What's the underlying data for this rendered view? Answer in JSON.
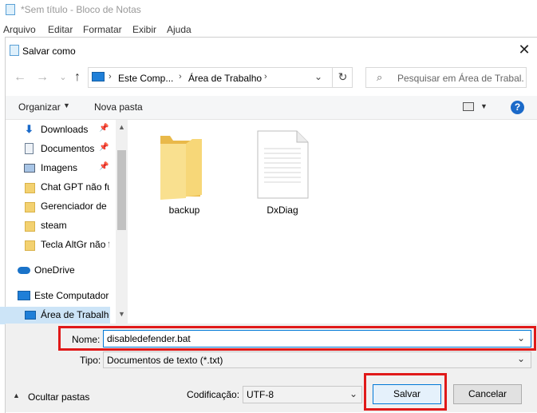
{
  "notepad": {
    "title": "*Sem título - Bloco de Notas",
    "menu": [
      "Arquivo",
      "Editar",
      "Formatar",
      "Exibir",
      "Ajuda"
    ]
  },
  "dialog": {
    "title": "Salvar como",
    "address": {
      "crumbs": [
        "Este Comp...",
        "Área de Trabalho"
      ]
    },
    "search": {
      "placeholder": "Pesquisar em Área de Trabal..."
    },
    "toolbar": {
      "organize": "Organizar",
      "new_folder": "Nova pasta",
      "help": "?"
    },
    "nav": [
      {
        "label": "Downloads",
        "icon": "download-icon",
        "pinned": true
      },
      {
        "label": "Documentos",
        "icon": "document-icon",
        "pinned": true
      },
      {
        "label": "Imagens",
        "icon": "image-icon",
        "pinned": true
      },
      {
        "label": "Chat GPT não fu",
        "icon": "folder-icon",
        "pinned": false
      },
      {
        "label": "Gerenciador de D",
        "icon": "folder-icon",
        "pinned": false
      },
      {
        "label": "steam",
        "icon": "folder-icon",
        "pinned": false
      },
      {
        "label": "Tecla AltGr não f",
        "icon": "folder-icon",
        "pinned": false
      },
      {
        "label": "OneDrive",
        "icon": "cloud-icon",
        "pinned": false
      },
      {
        "label": "Este Computador",
        "icon": "computer-icon",
        "pinned": false
      },
      {
        "label": "Área de Trabalho",
        "icon": "desktop-icon",
        "pinned": false
      }
    ],
    "files": [
      {
        "name": "backup",
        "type": "folder"
      },
      {
        "name": "DxDiag",
        "type": "text-file"
      }
    ],
    "filename": {
      "label": "Nome:",
      "value": "disabledefender.bat"
    },
    "filetype": {
      "label": "Tipo:",
      "value": "Documentos de texto (*.txt)"
    },
    "encoding": {
      "label": "Codificação:",
      "value": "UTF-8"
    },
    "hide_folders": "Ocultar pastas",
    "save": "Salvar",
    "cancel": "Cancelar"
  },
  "colors": {
    "highlight": "#e01919",
    "accent": "#0078d7"
  }
}
